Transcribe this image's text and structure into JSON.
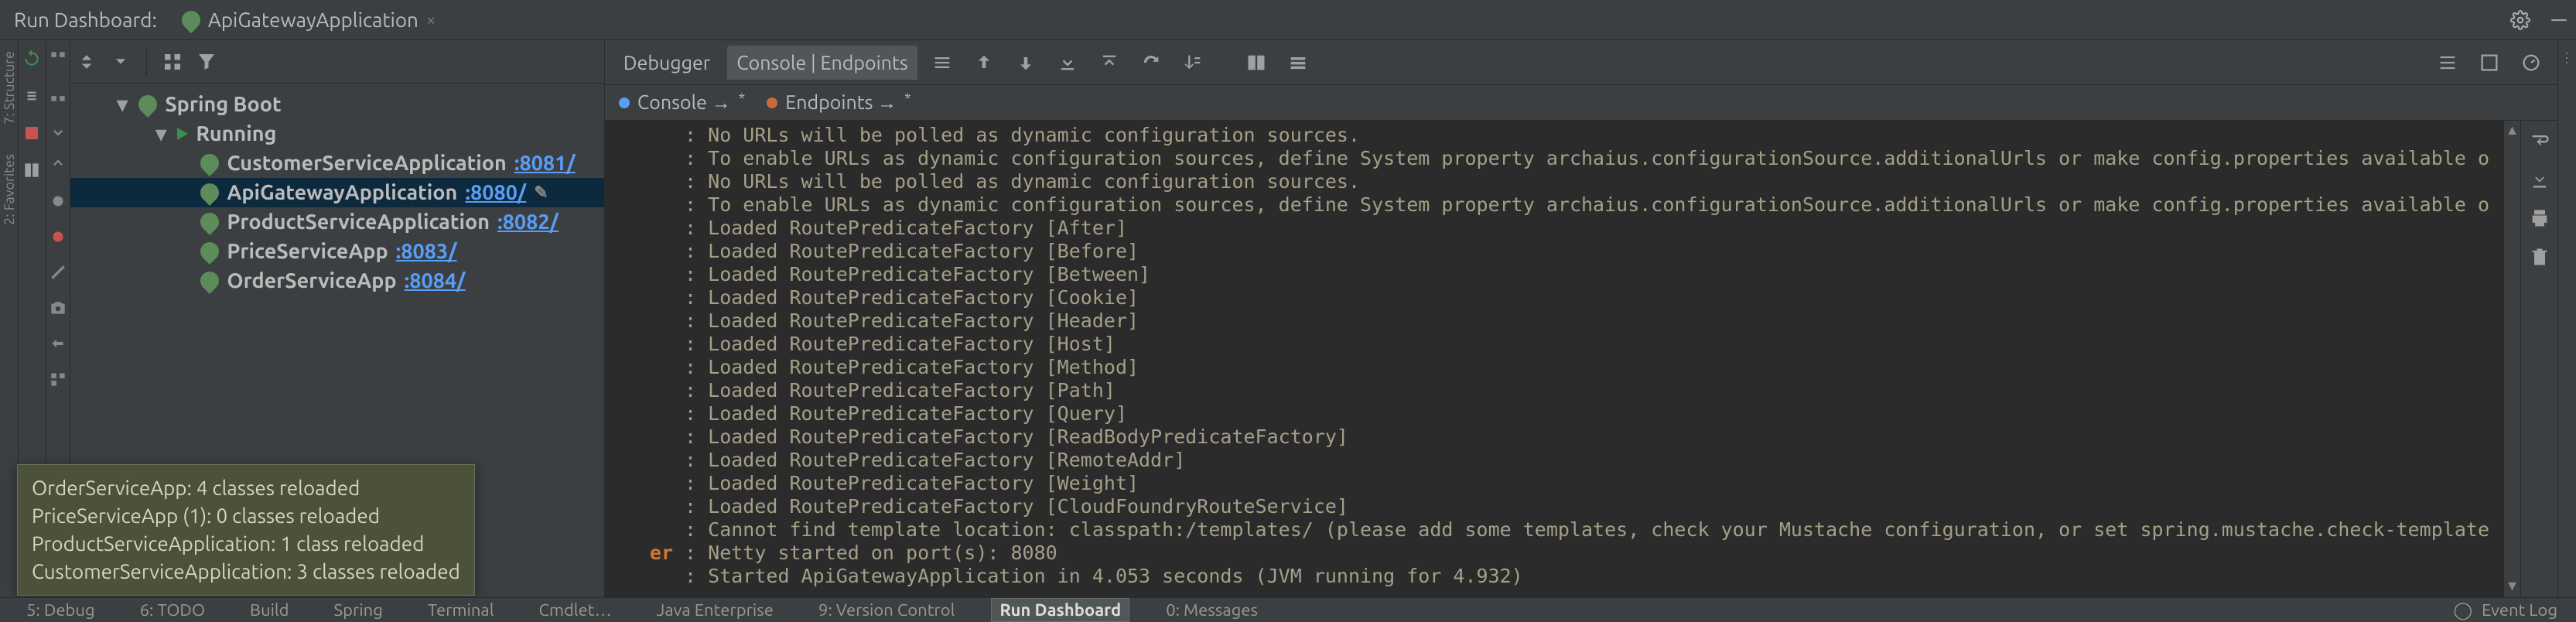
{
  "titlebar": {
    "label": "Run Dashboard:",
    "tab_label": "ApiGatewayApplication"
  },
  "run_tree": {
    "root": "Spring Boot",
    "group": "Running",
    "apps": [
      {
        "name": "CustomerServiceApplication",
        "port": ":8081/"
      },
      {
        "name": "ApiGatewayApplication",
        "port": ":8080/",
        "selected": true,
        "dirty_badge": true
      },
      {
        "name": "ProductServiceApplication",
        "port": ":8082/"
      },
      {
        "name": "PriceServiceApp",
        "port": ":8083/"
      },
      {
        "name": "OrderServiceApp",
        "port": ":8084/"
      }
    ]
  },
  "tabs_main": {
    "debugger": "Debugger",
    "console_endpoints": "Console | Endpoints"
  },
  "tabs_pinned": {
    "console": "Console →",
    "endpoints": "Endpoints →"
  },
  "console_lines": [
    ": No URLs will be polled as dynamic configuration sources.",
    ": To enable URLs as dynamic configuration sources, define System property archaius.configurationSource.additionalUrls or make config.properties available o",
    ": No URLs will be polled as dynamic configuration sources.",
    ": To enable URLs as dynamic configuration sources, define System property archaius.configurationSource.additionalUrls or make config.properties available o",
    ": Loaded RoutePredicateFactory [After]",
    ": Loaded RoutePredicateFactory [Before]",
    ": Loaded RoutePredicateFactory [Between]",
    ": Loaded RoutePredicateFactory [Cookie]",
    ": Loaded RoutePredicateFactory [Header]",
    ": Loaded RoutePredicateFactory [Host]",
    ": Loaded RoutePredicateFactory [Method]",
    ": Loaded RoutePredicateFactory [Path]",
    ": Loaded RoutePredicateFactory [Query]",
    ": Loaded RoutePredicateFactory [ReadBodyPredicateFactory]",
    ": Loaded RoutePredicateFactory [RemoteAddr]",
    ": Loaded RoutePredicateFactory [Weight]",
    ": Loaded RoutePredicateFactory [CloudFoundryRouteService]",
    ": Cannot find template location: classpath:/templates/ (please add some templates, check your Mustache configuration, or set spring.mustache.check-template",
    {
      "left_label": "er",
      "text": ": Netty started on port(s): 8080"
    },
    ": Started ApiGatewayApplication in 4.053 seconds (JVM running for 4.932)"
  ],
  "tooltip_lines": [
    "OrderServiceApp: 4 classes reloaded",
    "PriceServiceApp (1): 0 classes reloaded",
    "ProductServiceApplication: 1 class reloaded",
    "CustomerServiceApplication: 3 classes reloaded"
  ],
  "bottom": {
    "debug": "5: Debug",
    "todo": "6: TODO",
    "build": "Build",
    "spring": "Spring",
    "terminal": "Terminal",
    "cmdlet": "Cmdlet…",
    "java": "Java Enterprise",
    "vcs": "9: Version Control",
    "run": "Run Dashboard",
    "messages": "0: Messages",
    "eventlog": "Event Log"
  }
}
